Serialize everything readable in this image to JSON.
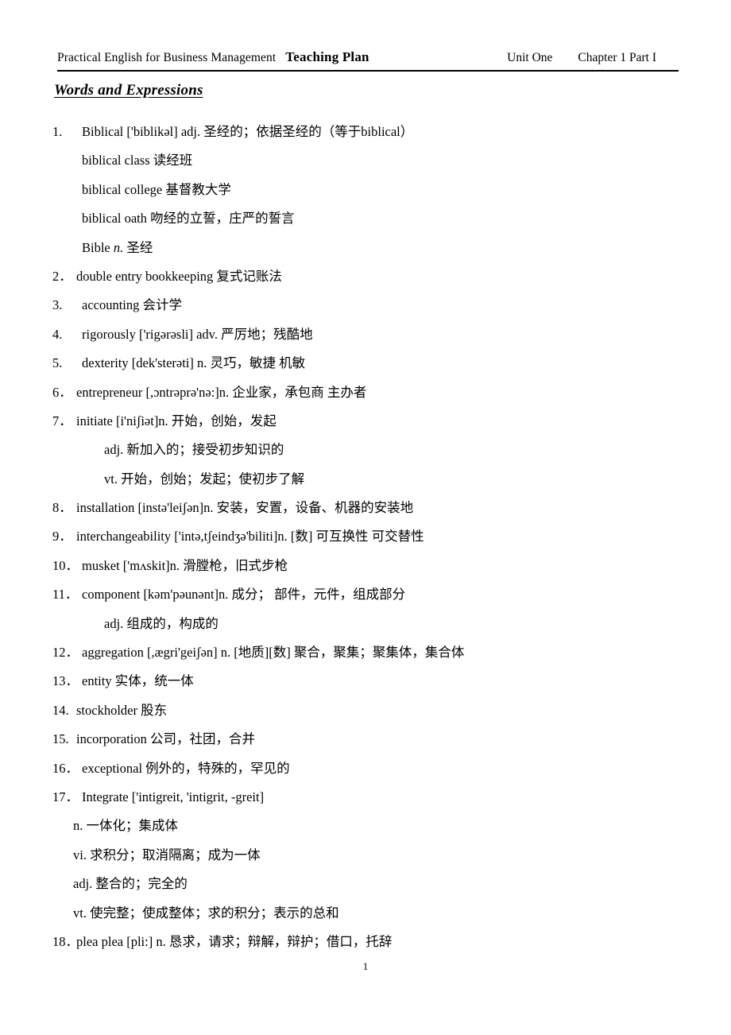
{
  "header": {
    "course": "Practical English for Business Management",
    "doc_title": "Teaching Plan",
    "unit": "Unit One",
    "chapter": "Chapter 1 Part I"
  },
  "section": {
    "title": "Words and Expressions"
  },
  "footer": {
    "page_number": "1"
  },
  "entries": [
    {
      "num": "1.",
      "text": "Biblical ['biblikəl] adj. 圣经的；依据圣经的（等于biblical）"
    },
    {
      "num": "2．",
      "text": "double entry bookkeeping      复式记账法"
    },
    {
      "num": "3.",
      "text": "accounting                            会计学"
    },
    {
      "num": "4.",
      "text": "rigorously    ['rigərəsli] adv. 严厉地；残酷地"
    },
    {
      "num": "5.",
      "text": "dexterity         [dek'sterəti] n.      灵巧，敏捷   机敏"
    },
    {
      "num": "6．",
      "text": "entrepreneur   [,ɔntrəprə'nə:]n.          企业家，承包商 主办者"
    },
    {
      "num": "7．",
      "text": "initiate   [i'niʃiət]n.          开始，创始，发起"
    },
    {
      "num": "8．",
      "text": "installation [instə'leiʃən]n. 安装，安置，设备、机器的安装地"
    },
    {
      "num": "9．",
      "text": "interchangeability ['intə,tʃeindʒə'biliti]n. [数]    可互换性   可交替性"
    },
    {
      "num": "10．",
      "text": "musket ['mʌskit]n.       滑膛枪，旧式步枪"
    },
    {
      "num": "11．",
      "text": "component [kəm'pəunənt]n. 成分；   部件，元件，组成部分"
    },
    {
      "num": "12．",
      "text": "aggregation [,ægri'geiʃən] n. [地质][数] 聚合，聚集；聚集体，集合体"
    },
    {
      "num": "13．",
      "text": "entity                          实体，统一体"
    },
    {
      "num": "14.",
      "text": "stockholder                  股东"
    },
    {
      "num": "15.",
      "text": "incorporation                公司，社团，合并"
    },
    {
      "num": "16．",
      "text": "exceptional                 例外的，特殊的，罕见的"
    },
    {
      "num": "17．",
      "text": "Integrate ['intigreit, 'intigrit, -greit]"
    },
    {
      "num": "18．",
      "text": "plea plea [pli:] n. 恳求，请求；辩解，辩护；借口，托辞"
    }
  ],
  "sub_lines": {
    "biblical_class": "biblical class    读经班",
    "biblical_college": "biblical college  基督教大学",
    "biblical_oath": "biblical oath  吻经的立誓，庄严的誓言",
    "bible_n_prefix": "Bible ",
    "bible_n_italic": "n.",
    "bible_n_suffix": " 圣经",
    "initiate_adj": "adj. 新加入的；接受初步知识的",
    "initiate_vt": "vt. 开始，创始；发起；使初步了解",
    "component_adj": "adj. 组成的，构成的",
    "integrate_n": "n. 一体化；集成体",
    "integrate_vi": "vi. 求积分；取消隔离；成为一体",
    "integrate_adj": "adj. 整合的；完全的",
    "integrate_vt": "vt. 使完整；使成整体；求的积分；表示的总和"
  }
}
